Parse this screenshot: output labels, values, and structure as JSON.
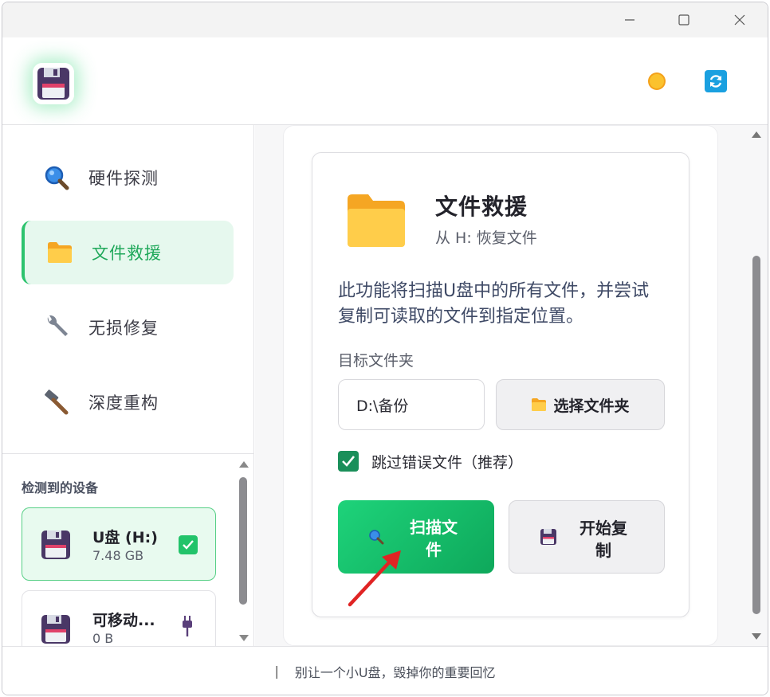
{
  "window": {
    "minimize_icon": "minimize-icon",
    "maximize_icon": "maximize-icon",
    "close_icon": "close-icon"
  },
  "header": {
    "logo_icon": "floppy-disk-icon",
    "theme_icon": "sun-icon",
    "refresh_icon": "refresh-icon"
  },
  "sidebar": {
    "items": [
      {
        "label": "硬件探测",
        "icon": "magnifier-icon",
        "active": false
      },
      {
        "label": "文件救援",
        "icon": "folder-icon",
        "active": true
      },
      {
        "label": "无损修复",
        "icon": "wrench-icon",
        "active": false
      },
      {
        "label": "深度重构",
        "icon": "hammer-icon",
        "active": false
      }
    ],
    "devices_title": "检测到的设备",
    "devices": [
      {
        "name": "U盘 (H:)",
        "size": "7.48 GB",
        "selected": true
      },
      {
        "name": "可移动...",
        "size": "0 B",
        "selected": false
      }
    ]
  },
  "card": {
    "title": "文件救援",
    "subtitle": "从 H: 恢复文件",
    "description": "此功能将扫描U盘中的所有文件，并尝试复制可读取的文件到指定位置。",
    "target_label": "目标文件夹",
    "target_path": "D:\\备份",
    "choose_button": "选择文件夹",
    "skip_errors_label": "跳过错误文件（推荐）",
    "skip_errors_checked": true,
    "scan_button_line1": "扫描文",
    "scan_button_line2": "件",
    "copy_button_line1": "开始复",
    "copy_button_line2": "制"
  },
  "footer": {
    "separator": "|",
    "text": "别让一个小U盘，毁掉你的重要回忆"
  },
  "colors": {
    "accent": "#22c36a",
    "accent_dark": "#0ea85b",
    "active_bg": "#e6f8ee",
    "annotation_arrow": "#e02424"
  }
}
